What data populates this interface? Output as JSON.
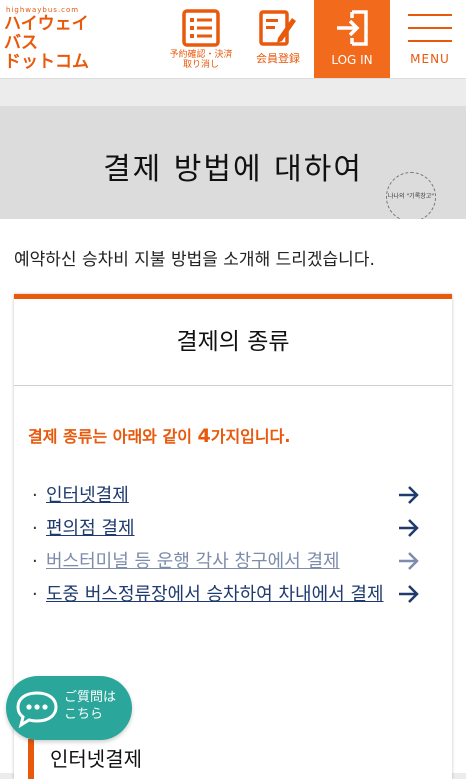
{
  "header": {
    "logo_small": "highwaybus.com",
    "logo_main": "ハイウェイ\nバス\nドットコム",
    "reserve_label": "予約確認・決済\n取り消し",
    "member_label": "会員登録",
    "login_label": "LOG IN",
    "menu_label": "MENU"
  },
  "page": {
    "title": "결제 방법에 대하여",
    "stamp_text": "나나의 \"기록창고\"",
    "intro": "예약하신 승차비 지불 방법을 소개해 드리겠습니다."
  },
  "card": {
    "header": "결제의 종류",
    "lead_before": "결제 종류는 아래와 같이 ",
    "lead_num": "4",
    "lead_after": "가지입니다.",
    "methods": [
      {
        "label": "인터넷결제"
      },
      {
        "label": "편의점 결제"
      },
      {
        "label": "버스터미널 등 운행 각사 창구에서 결제"
      },
      {
        "label": "도중 버스정류장에서 승차하여 차내에서 결제"
      }
    ],
    "section_head": "인터넷결제"
  },
  "chat": {
    "label": "ご質問は\nこちら"
  },
  "colors": {
    "accent": "#e8590c",
    "login_bg": "#f26a1b",
    "link": "#1f3a6e",
    "chat": "#2aa69a"
  }
}
